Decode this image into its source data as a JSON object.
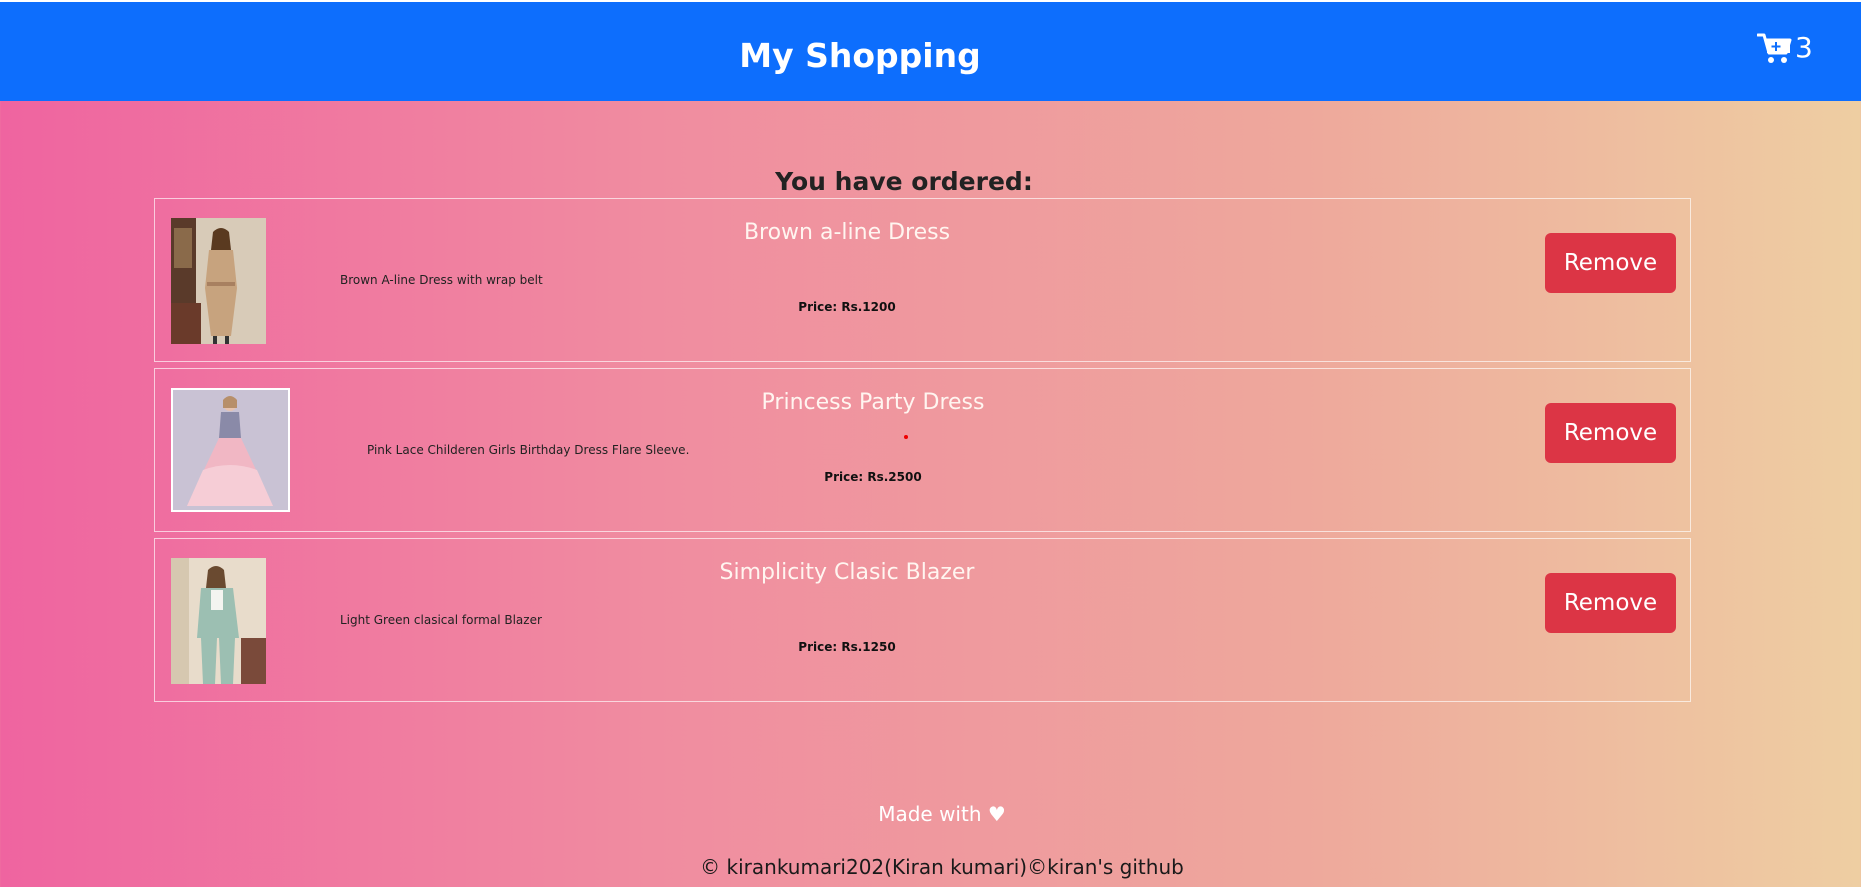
{
  "navbar": {
    "brand": "My Shopping",
    "cart_count": "3",
    "bg_color": "#0d6efd"
  },
  "heading": "You have ordered:",
  "items": [
    {
      "title": "Brown a-line Dress",
      "description": "Brown A-line Dress with wrap belt",
      "price": "Price: Rs.1200",
      "remove_label": "Remove"
    },
    {
      "title": "Princess Party Dress",
      "description": "Pink Lace Childeren Girls Birthday Dress Flare Sleeve.",
      "price": "Price: Rs.2500",
      "remove_label": "Remove"
    },
    {
      "title": "Simplicity Clasic Blazer",
      "description": "Light Green clasical formal Blazer",
      "price": "Price: Rs.1250",
      "remove_label": "Remove"
    }
  ],
  "footer": {
    "made_with": "Made with ♥",
    "copyright": "© kirankumari202(Kiran kumari)©kiran's github"
  },
  "colors": {
    "remove_button": "#dc3545",
    "accent": "#0d6efd"
  },
  "icons": {
    "cart": "cart-plus-icon"
  }
}
